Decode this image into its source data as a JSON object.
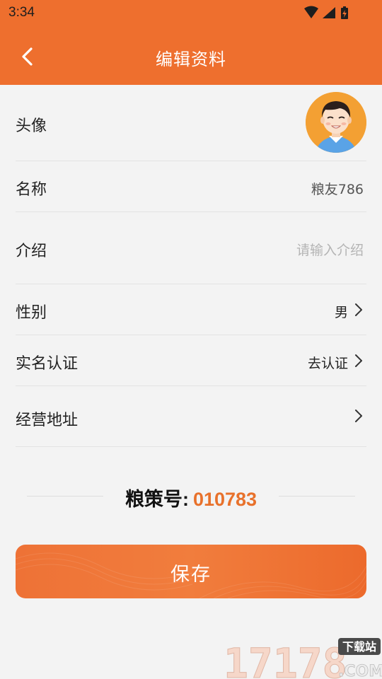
{
  "status_bar": {
    "time": "3:34"
  },
  "header": {
    "title": "编辑资料"
  },
  "rows": {
    "avatar": {
      "label": "头像"
    },
    "name": {
      "label": "名称",
      "value": "粮友786"
    },
    "intro": {
      "label": "介绍",
      "placeholder": "请输入介绍"
    },
    "gender": {
      "label": "性别",
      "value": "男"
    },
    "verify": {
      "label": "实名认证",
      "value": "去认证"
    },
    "address": {
      "label": "经营地址"
    }
  },
  "account": {
    "label": "粮策号",
    "separator": ":",
    "value": "010783"
  },
  "save_button": {
    "label": "保存"
  },
  "watermark": {
    "number": "17178",
    "badge": "下载站",
    "suffix": ".COM"
  },
  "colors": {
    "brand": "#ee6f2e",
    "accent_text": "#e8712b",
    "background": "#f3f3f3"
  }
}
